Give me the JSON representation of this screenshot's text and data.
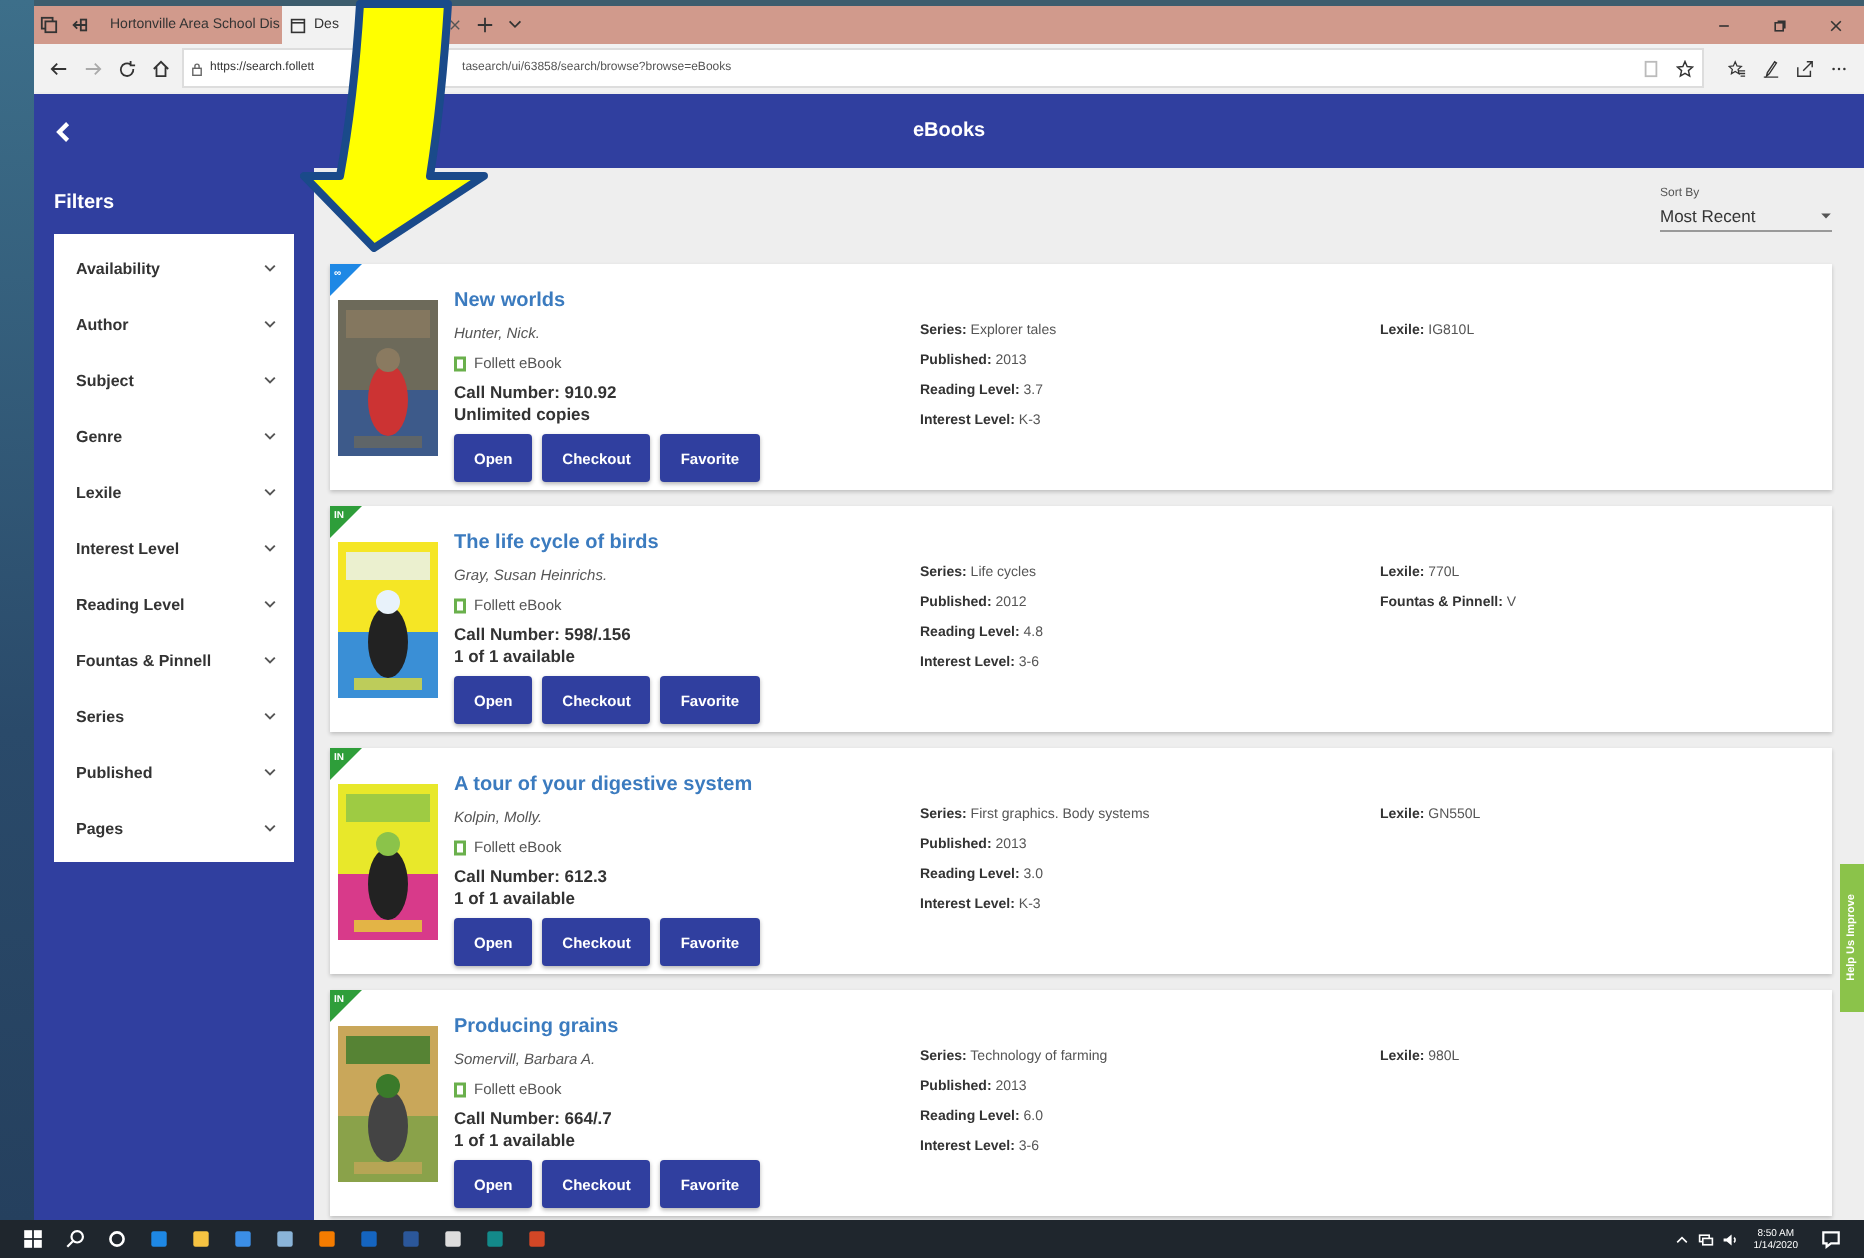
{
  "browser": {
    "tabs": [
      {
        "title": "Hortonville Area School Dis",
        "selected": false
      },
      {
        "title": "Des",
        "selected": true
      }
    ],
    "url_start": "https://search.follett",
    "url_end": "tasearch/ui/63858/search/browse?browse=eBooks"
  },
  "header": {
    "title": "eBooks"
  },
  "sidebar": {
    "title": "Filters",
    "filters": [
      {
        "label": "Availability",
        "expanded": false
      },
      {
        "label": "Author",
        "expanded": false
      },
      {
        "label": "Subject",
        "expanded": false
      },
      {
        "label": "Genre",
        "expanded": false
      },
      {
        "label": "Lexile",
        "expanded": false
      },
      {
        "label": "Interest Level",
        "expanded": false
      },
      {
        "label": "Reading Level",
        "expanded": false
      },
      {
        "label": "Fountas & Pinnell",
        "expanded": false
      },
      {
        "label": "Series",
        "expanded": false
      },
      {
        "label": "Published",
        "expanded": false
      },
      {
        "label": "Pages",
        "expanded": false
      }
    ]
  },
  "sort": {
    "label": "Sort By",
    "value": "Most Recent"
  },
  "results": [
    {
      "badge": {
        "text": "∞",
        "color": "#1e88e5"
      },
      "title": "New worlds",
      "author": "Hunter, Nick.",
      "format": "Follett eBook",
      "call_number": "Call Number: 910.92",
      "availability": "Unlimited copies",
      "buttons": [
        "Open",
        "Checkout",
        "Favorite"
      ],
      "details": [
        {
          "label": "Series:",
          "value": "Explorer tales"
        },
        {
          "label": "Published:",
          "value": "2013"
        },
        {
          "label": "Reading Level:",
          "value": "3.7"
        },
        {
          "label": "Interest Level:",
          "value": "K-3"
        }
      ],
      "extra": [
        {
          "label": "Lexile:",
          "value": "IG810L"
        }
      ]
    },
    {
      "badge": {
        "text": "IN",
        "color": "#2e9e3a"
      },
      "title": "The life cycle of birds",
      "author": "Gray, Susan Heinrichs.",
      "format": "Follett eBook",
      "call_number": "Call Number: 598/.156",
      "availability": "1 of 1 available",
      "buttons": [
        "Open",
        "Checkout",
        "Favorite"
      ],
      "details": [
        {
          "label": "Series:",
          "value": "Life cycles"
        },
        {
          "label": "Published:",
          "value": "2012"
        },
        {
          "label": "Reading Level:",
          "value": "4.8"
        },
        {
          "label": "Interest Level:",
          "value": "3-6"
        }
      ],
      "extra": [
        {
          "label": "Lexile:",
          "value": "770L"
        },
        {
          "label": "Fountas & Pinnell:",
          "value": "V"
        }
      ]
    },
    {
      "badge": {
        "text": "IN",
        "color": "#2e9e3a"
      },
      "title": "A tour of your digestive system",
      "author": "Kolpin, Molly.",
      "format": "Follett eBook",
      "call_number": "Call Number: 612.3",
      "availability": "1 of 1 available",
      "buttons": [
        "Open",
        "Checkout",
        "Favorite"
      ],
      "details": [
        {
          "label": "Series:",
          "value": "First graphics. Body systems"
        },
        {
          "label": "Published:",
          "value": "2013"
        },
        {
          "label": "Reading Level:",
          "value": "3.0"
        },
        {
          "label": "Interest Level:",
          "value": "K-3"
        }
      ],
      "extra": [
        {
          "label": "Lexile:",
          "value": "GN550L"
        }
      ]
    },
    {
      "badge": {
        "text": "IN",
        "color": "#2e9e3a"
      },
      "title": "Producing grains",
      "author": "Somervill, Barbara A.",
      "format": "Follett eBook",
      "call_number": "Call Number: 664/.7",
      "availability": "1 of 1 available",
      "buttons": [
        "Open",
        "Checkout",
        "Favorite"
      ],
      "details": [
        {
          "label": "Series:",
          "value": "Technology of farming"
        },
        {
          "label": "Published:",
          "value": "2013"
        },
        {
          "label": "Reading Level:",
          "value": "6.0"
        },
        {
          "label": "Interest Level:",
          "value": "3-6"
        }
      ],
      "extra": [
        {
          "label": "Lexile:",
          "value": "980L"
        }
      ]
    }
  ],
  "feedback_tab": {
    "label": "Help Us Improve"
  },
  "taskbar": {
    "time": "8:50 AM",
    "date": "1/14/2020"
  }
}
